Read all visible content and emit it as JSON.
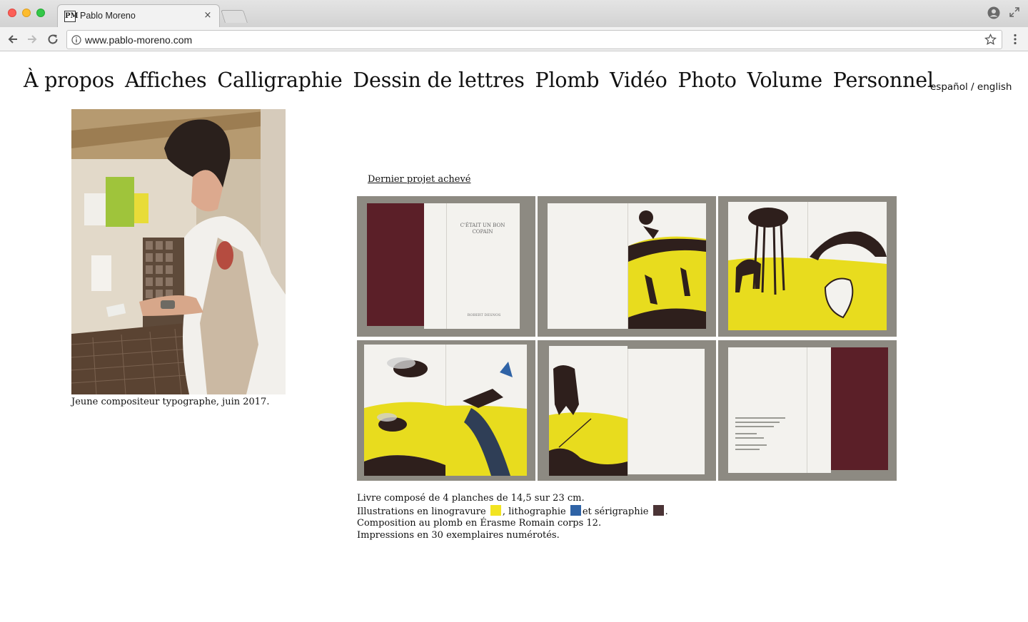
{
  "browser": {
    "tab_title": "Pablo Moreno",
    "favicon_text": "PM",
    "tab_close": "×",
    "url": "www.pablo-moreno.com"
  },
  "site": {
    "nav": [
      {
        "label": "À propos"
      },
      {
        "label": "Affiches"
      },
      {
        "label": "Calligraphie"
      },
      {
        "label": "Dessin de lettres"
      },
      {
        "label": "Plomb"
      },
      {
        "label": "Vidéo"
      },
      {
        "label": "Photo"
      },
      {
        "label": "Volume"
      },
      {
        "label": "Personnel"
      }
    ],
    "lang": {
      "es": "español",
      "sep": " / ",
      "en": "english"
    },
    "portrait_caption": "Jeune compositeur typographe, juin 2017.",
    "project_link": "Dernier projet achevé",
    "book_title_lines": [
      "C'ÉTAIT UN BON",
      "COPAIN"
    ],
    "book_author": "ROBERT DESNOS",
    "description": {
      "line1": "Livre composé de 4 planches de 14,5 sur 23 cm.",
      "line2_a": "Illustrations en linogravure",
      "line2_b": ", lithographie",
      "line2_c": "et sérigraphie",
      "line2_d": ".",
      "line3": "Composition au plomb en Érasme Romain corps 12.",
      "line4": "Impressions en 30 exemplaires numérotés."
    },
    "colors": {
      "linogravure": "#f2e421",
      "lithographie": "#2f63a6",
      "serigraphie": "#4b3436",
      "cover": "#5b1f28",
      "ink": "#2e1f1c",
      "yellow_print": "#e8dc1e",
      "table": "#8d8a82"
    }
  }
}
